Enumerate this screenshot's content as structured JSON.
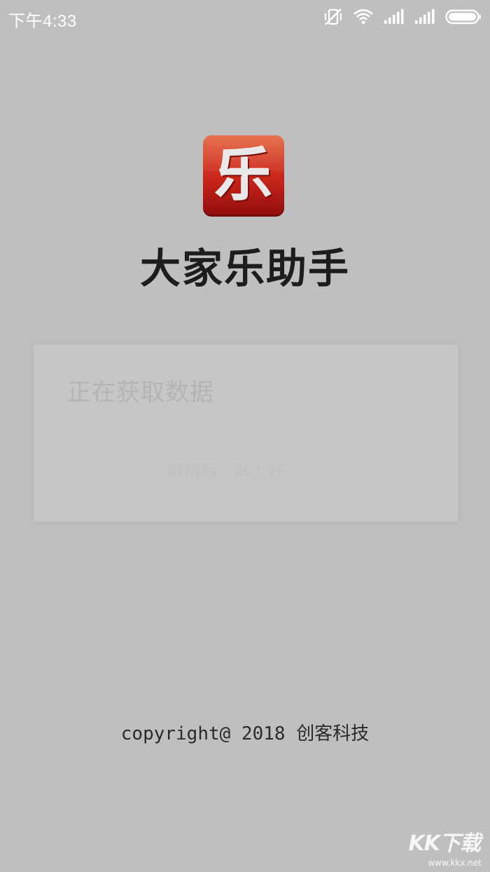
{
  "status_bar": {
    "time": "下午4:33",
    "icons": [
      "mute-vibrate-icon",
      "wifi-icon",
      "signal-icon",
      "signal-icon",
      "battery-icon"
    ]
  },
  "app": {
    "logo_glyph": "乐",
    "title": "大家乐助手"
  },
  "dialog": {
    "loading_text": "正在获取数据",
    "sub_text": "请稍后，马上好"
  },
  "footer": {
    "copyright": "copyright@ 2018 创客科技"
  },
  "watermark": {
    "logo": "KK下载",
    "url": "www.kkx.net"
  },
  "colors": {
    "background": "#bfbfbf",
    "logo_red": "#c8241a",
    "title": "#1d1d1d"
  }
}
